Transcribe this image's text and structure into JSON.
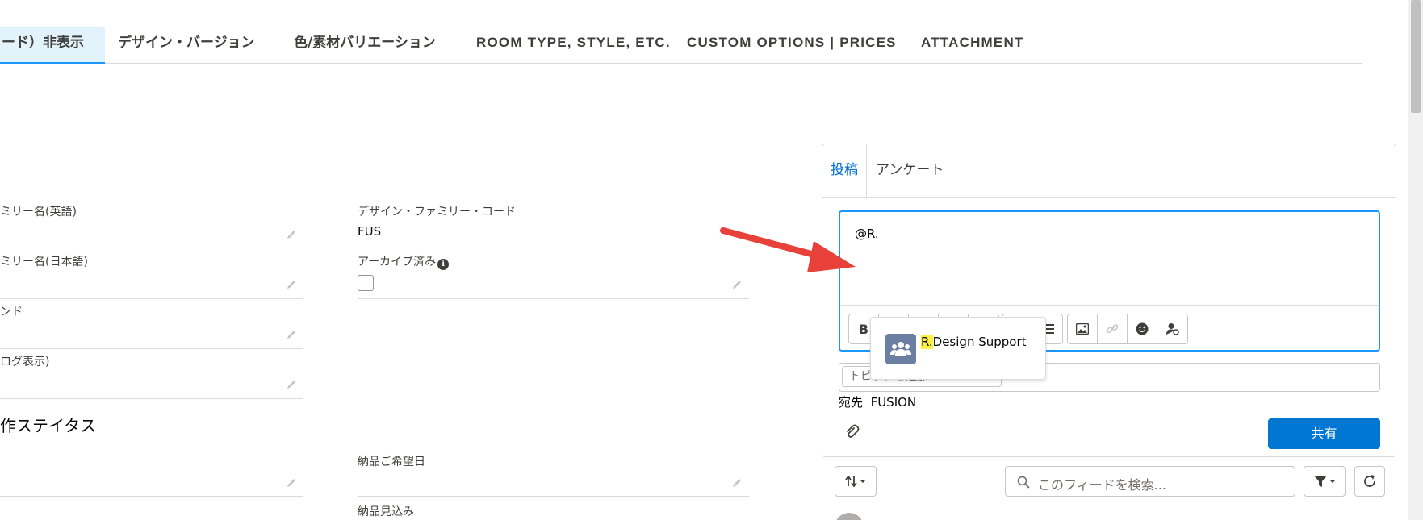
{
  "tabs": [
    {
      "label": "ード）非表示",
      "active": true
    },
    {
      "label": "デザイン・バージョン"
    },
    {
      "label": "色/素材バリエーション"
    },
    {
      "label": "ROOM TYPE, STYLE, ETC."
    },
    {
      "label": "CUSTOM OPTIONS | PRICES"
    },
    {
      "label": "ATTACHMENT"
    }
  ],
  "form": {
    "left": [
      {
        "label": "ミリー名(英語)",
        "value": ""
      },
      {
        "label": "ミリー名(日本語)",
        "value": ""
      },
      {
        "label": "ンド",
        "value": ""
      },
      {
        "label": "ログ表示)",
        "value": ""
      }
    ],
    "right": [
      {
        "label": "デザイン・ファミリー・コード",
        "value": "FUS"
      },
      {
        "label": "アーカイブ済み",
        "value": ""
      }
    ],
    "section_title": "作ステイタス",
    "delivery_requested_label": "納品ご希望日",
    "delivery_expected_label": "納品見込み"
  },
  "publisher": {
    "tab_post": "投稿",
    "tab_poll": "アンケート",
    "editor_text": "@R.",
    "mention": {
      "highlight": "R.",
      "rest": "Design Support"
    },
    "topic_placeholder": "トピックを追加",
    "to_label": "宛先",
    "to_value": "FUSION",
    "share_label": "共有"
  },
  "feed": {
    "search_placeholder": "このフィードを検索..."
  },
  "colors": {
    "brand_blue": "#0176d3",
    "focus_blue": "#1b96ff",
    "active_tab_bg": "#e3f3fc",
    "arrow_red": "#e8413a",
    "mention_highlight": "#fff03f"
  }
}
